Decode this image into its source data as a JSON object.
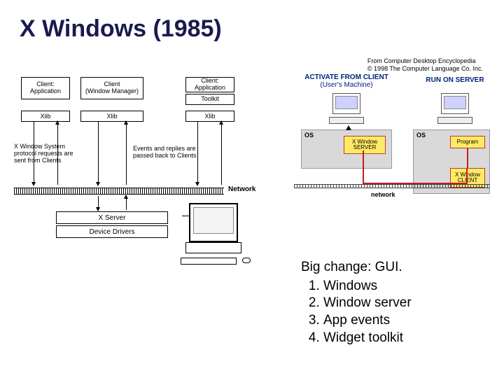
{
  "title": "X Windows (1985)",
  "attribution": {
    "line1": "From Computer Desktop Encyclopedia",
    "line2": "© 1998 The Computer Language Co. Inc."
  },
  "left": {
    "client1_line1": "Client:",
    "client1_line2": "Application",
    "client2_line1": "Client",
    "client2_line2": "(Window Manager)",
    "client3_line1": "Client:",
    "client3_line2": "Application",
    "toolkit": "Toolkit",
    "xlib": "Xlib",
    "annot1": "X Window System protocol requests are sent from Clients",
    "annot2": "Events and replies are passed back to Clients",
    "network": "Network",
    "xserver": "X Server",
    "drivers": "Device Drivers"
  },
  "right": {
    "activate_title": "ACTIVATE FROM CLIENT",
    "activate_sub": "(User's Machine)",
    "run_title": "RUN ON SERVER",
    "os": "OS",
    "xwindow_server": "X Window SERVER",
    "program": "Program",
    "xwindow_client": "X Window CLIENT",
    "network": "network"
  },
  "bullets": {
    "lead": "Big change: GUI.",
    "items": [
      "Windows",
      "Window server",
      "App events",
      "Widget toolkit"
    ]
  }
}
